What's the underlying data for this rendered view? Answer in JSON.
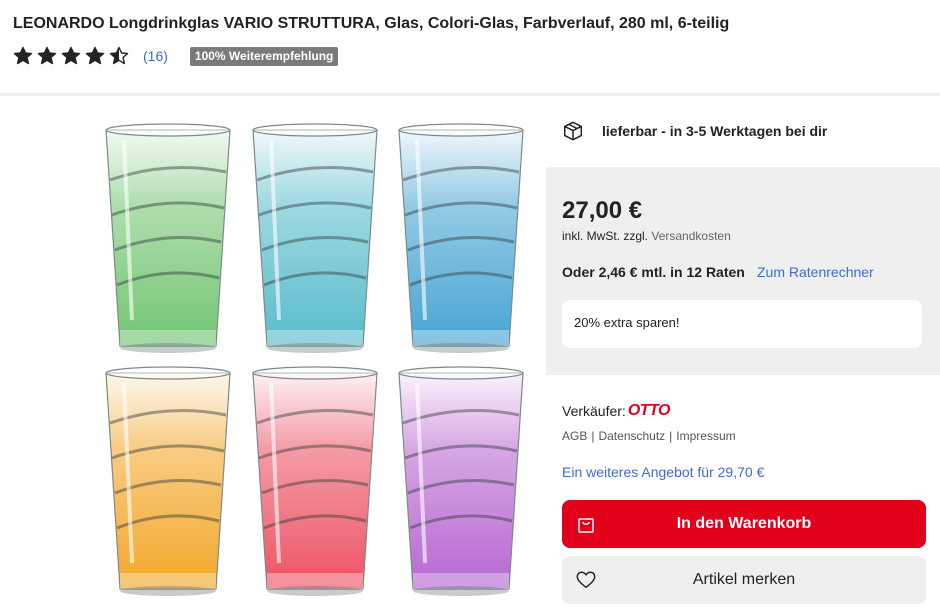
{
  "product": {
    "title": "LEONARDO Longdrinkglas VARIO STRUTTURA, Glas, Colori-Glas, Farbverlauf, 280 ml, 6-teilig",
    "rating": 4.5,
    "rating_max": 5,
    "review_count": "(16)",
    "recommendation_badge": "100% Weiterempfehlung"
  },
  "gallery": {
    "glasses": [
      {
        "name": "glass-green",
        "color": "#6cc26a"
      },
      {
        "name": "glass-turquoise",
        "color": "#4fb8c9"
      },
      {
        "name": "glass-blue",
        "color": "#3d9fd0"
      },
      {
        "name": "glass-orange",
        "color": "#f2a21e"
      },
      {
        "name": "glass-red",
        "color": "#ec4a5c"
      },
      {
        "name": "glass-purple",
        "color": "#b45fcf"
      }
    ]
  },
  "delivery": {
    "icon": "package-icon",
    "text": "lieferbar - in 3-5 Werktagen bei dir"
  },
  "pricing": {
    "price": "27,00 €",
    "tax_note": "inkl. MwSt. zzgl.",
    "shipping_link": "Versandkosten",
    "installment_text": "Oder 2,46 € mtl. in 12 Raten",
    "installment_link": "Zum Ratenrechner",
    "promo_text": "20% extra sparen!"
  },
  "seller": {
    "label": "Verkäufer:",
    "name": "OTTO",
    "links": [
      "AGB",
      "Datenschutz",
      "Impressum"
    ],
    "separator": "|",
    "other_offer": "Ein weiteres Angebot für 29,70 €"
  },
  "actions": {
    "cart_label": "In den Warenkorb",
    "cart_icon": "shopping-bag-icon",
    "wishlist_label": "Artikel merken",
    "wishlist_icon": "heart-icon"
  },
  "colors": {
    "accent_red": "#e3001b",
    "link_blue": "#3d6bd6",
    "panel_gray": "#efefef",
    "badge_gray": "#7a7a7a"
  }
}
